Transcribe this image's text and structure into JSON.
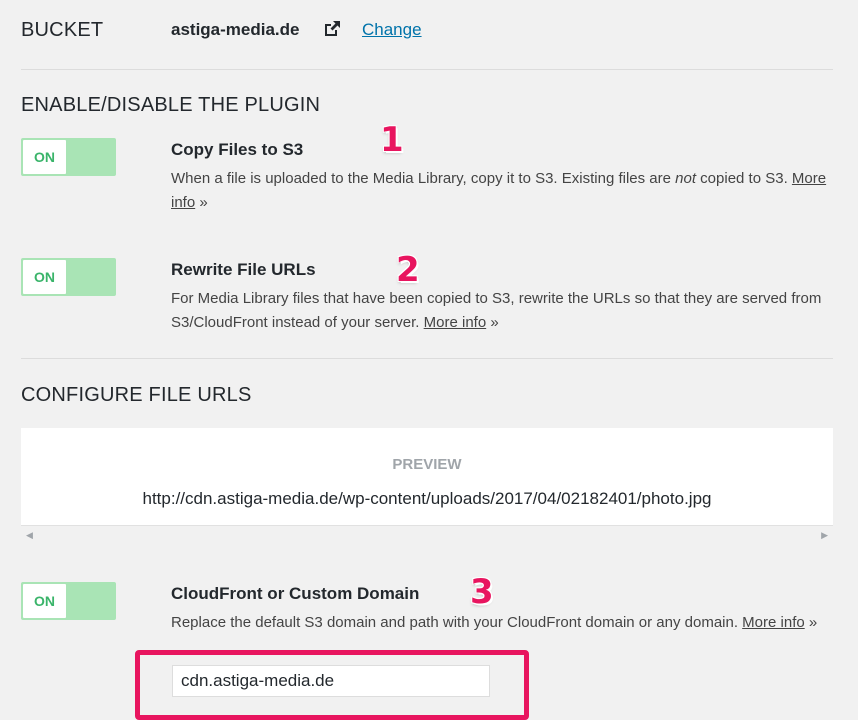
{
  "bucket": {
    "label": "BUCKET",
    "name": "astiga-media.de",
    "external_icon": "external-link-icon",
    "change_label": "Change"
  },
  "plugin": {
    "heading": "ENABLE/DISABLE THE PLUGIN",
    "copy_files": {
      "toggle_label": "ON",
      "title": "Copy Files to S3",
      "desc_before": "When a file is uploaded to the Media Library, copy it to S3. Existing files are ",
      "desc_em": "not",
      "desc_after": " copied to S3. ",
      "more_info": "More info",
      "raquo": " »",
      "callout": "1"
    },
    "rewrite_urls": {
      "toggle_label": "ON",
      "title": "Rewrite File URLs",
      "desc": "For Media Library files that have been copied to S3, rewrite the URLs so that they are served from S3/CloudFront instead of your server. ",
      "more_info": "More info",
      "raquo": " »",
      "callout": "2"
    }
  },
  "configure": {
    "heading": "CONFIGURE FILE URLS",
    "preview_label": "PREVIEW",
    "preview_url": "http://cdn.astiga-media.de/wp-content/uploads/2017/04/02182401/photo.jpg",
    "cloudfront": {
      "toggle_label": "ON",
      "title": "CloudFront or Custom Domain",
      "desc": "Replace the default S3 domain and path with your CloudFront domain or any domain. ",
      "more_info": "More info",
      "raquo": " »",
      "callout": "3",
      "domain_value": "cdn.astiga-media.de"
    }
  },
  "colors": {
    "toggle_on": "#a9e4b5",
    "toggle_text": "#3ab46a",
    "link": "#0073aa",
    "callout": "#e8155f"
  }
}
